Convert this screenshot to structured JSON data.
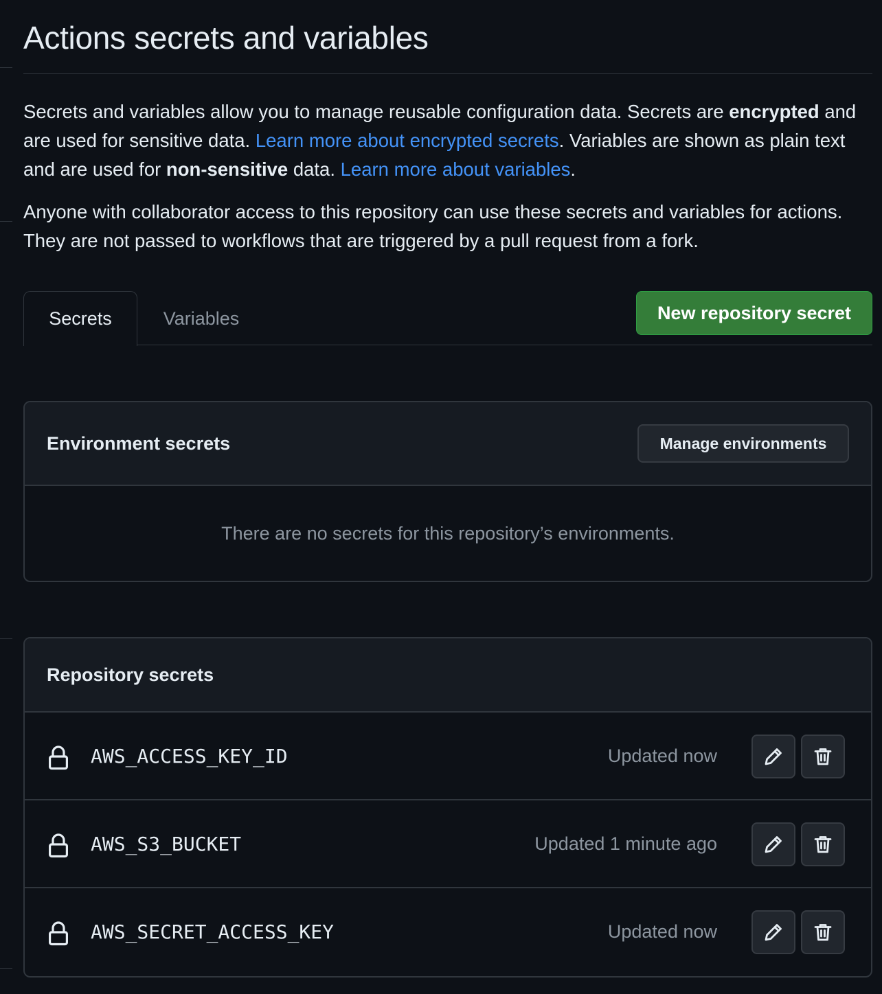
{
  "page": {
    "title": "Actions secrets and variables",
    "intro": {
      "t1": "Secrets and variables allow you to manage reusable configuration data. Secrets are ",
      "b1": "encrypted",
      "t2": " and are used for sensitive data. ",
      "link1": "Learn more about encrypted secrets",
      "t3": ". Variables are shown as plain text and are used for ",
      "b2": "non-sensitive",
      "t4": " data. ",
      "link2": "Learn more about variables",
      "t5": "."
    },
    "access_note": "Anyone with collaborator access to this repository can use these secrets and variables for actions. They are not passed to workflows that are triggered by a pull request from a fork."
  },
  "tabs": [
    {
      "label": "Secrets",
      "selected": true
    },
    {
      "label": "Variables",
      "selected": false
    }
  ],
  "new_secret_button": "New repository secret",
  "environment_secrets": {
    "title": "Environment secrets",
    "manage_button": "Manage environments",
    "empty_message": "There are no secrets for this repository’s environments."
  },
  "repository_secrets": {
    "title": "Repository secrets",
    "items": [
      {
        "name": "AWS_ACCESS_KEY_ID",
        "updated": "Updated now"
      },
      {
        "name": "AWS_S3_BUCKET",
        "updated": "Updated 1 minute ago"
      },
      {
        "name": "AWS_SECRET_ACCESS_KEY",
        "updated": "Updated now"
      }
    ]
  },
  "icons": {
    "row_icon": "lock-icon",
    "edit": "pencil-icon",
    "delete": "trash-icon"
  },
  "colors": {
    "background": "#0d1117",
    "link": "#4493f8",
    "primary_button": "#347d39",
    "muted_text": "#8d96a0",
    "border": "#30363d"
  }
}
